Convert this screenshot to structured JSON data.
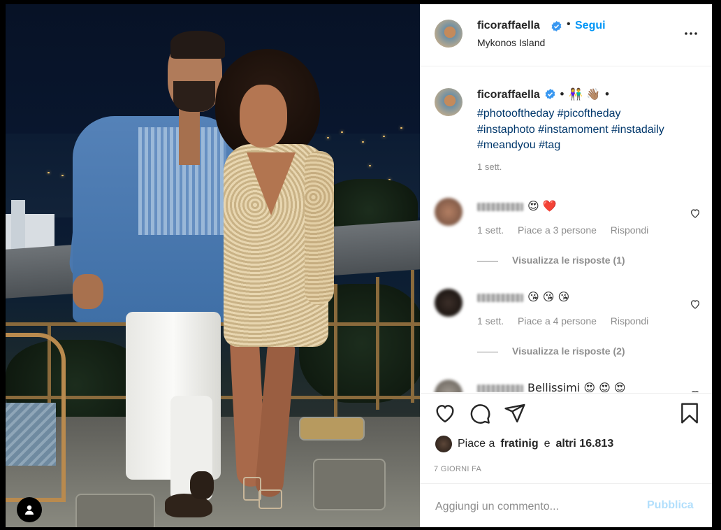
{
  "post": {
    "username": "ficoraffaella",
    "follow_label": "Segui",
    "location": "Mykonos Island"
  },
  "caption": {
    "username": "ficoraffaella",
    "emoji_line": "• 👫 👋🏽 •",
    "hashtags": [
      "#photooftheday",
      "#picoftheday",
      "#instaphoto",
      "#instamoment",
      "#instadaily",
      "#meandyou",
      "#tag"
    ],
    "time": "1 sett."
  },
  "comments": [
    {
      "text": "😍 ❤️",
      "time": "1 sett.",
      "likes": "Piace a 3 persone",
      "reply": "Rispondi",
      "view_replies": "Visualizza le risposte (1)"
    },
    {
      "text": "😘 😘 😘",
      "time": "1 sett.",
      "likes": "Piace a 4 persone",
      "reply": "Rispondi",
      "view_replies": "Visualizza le risposte (2)"
    },
    {
      "text": "Bellissimi 😍 😍 😍"
    }
  ],
  "actions": {
    "likes_prefix": "Piace a",
    "likes_user": "fratinig",
    "likes_joiner": "e",
    "likes_rest": "altri 16.813",
    "date": "7 GIORNI FA"
  },
  "composer": {
    "placeholder": "Aggiungi un commento...",
    "publish_label": "Pubblica"
  },
  "colors": {
    "link_blue": "#0095f6",
    "hashtag_blue": "#00376b",
    "muted_text": "#8e8e8e",
    "disabled_publish": "#b2dffc",
    "verified": "#3897f0"
  },
  "icons": [
    "verified-badge-icon",
    "more-options-icon",
    "heart-icon",
    "comment-icon",
    "share-icon",
    "bookmark-icon",
    "user-tag-icon"
  ]
}
